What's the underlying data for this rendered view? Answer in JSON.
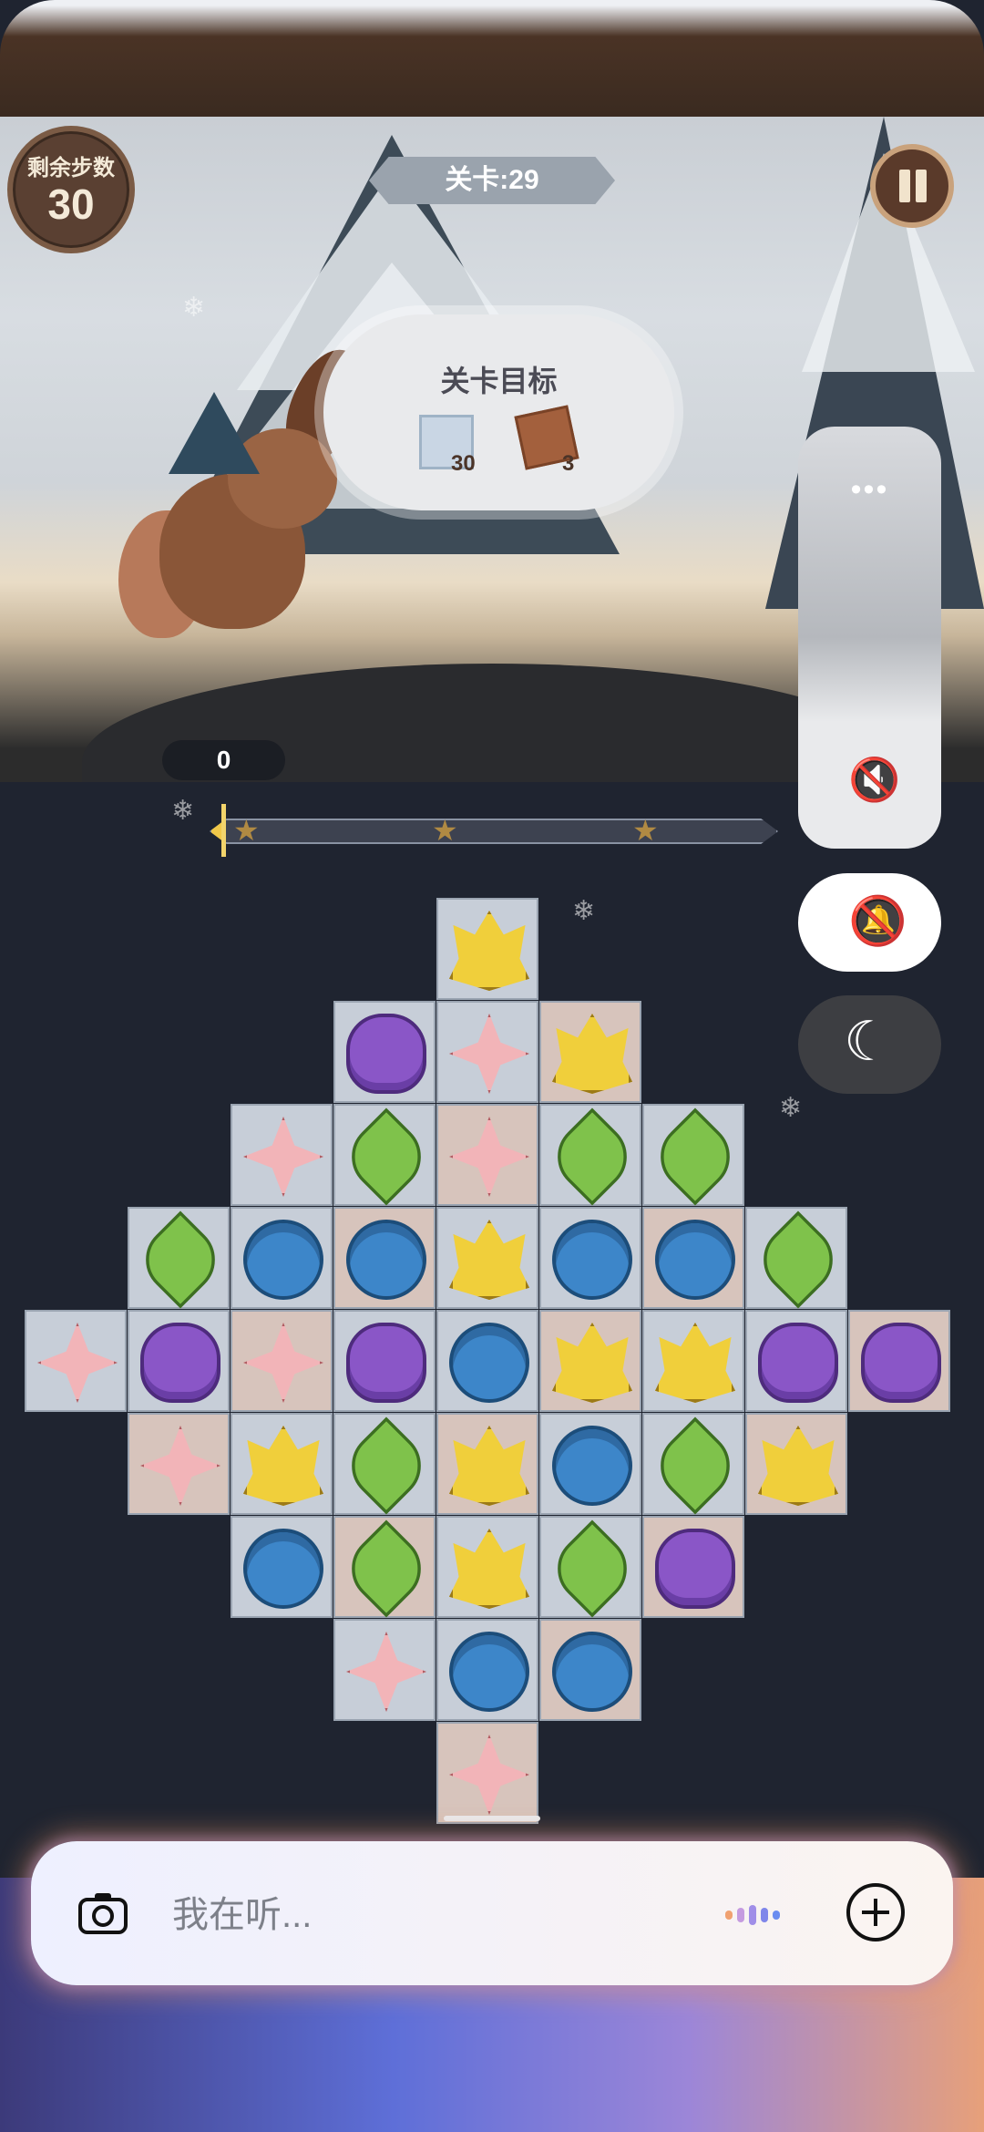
{
  "hud": {
    "steps_label": "剩余步数",
    "steps_value": "30",
    "level_label": "关卡:29"
  },
  "goal": {
    "title": "关卡目标",
    "items": [
      {
        "icon": "ice-tile-icon",
        "count": "30"
      },
      {
        "icon": "crate-icon",
        "count": "3"
      }
    ]
  },
  "score": {
    "value": "0",
    "progress": 0.02,
    "stars": 3
  },
  "board": {
    "rows": [
      [
        "-",
        "-",
        "-",
        "-",
        "yellow",
        "-",
        "-",
        "-",
        "-"
      ],
      [
        "-",
        "-",
        "-",
        "purple",
        "pink",
        "yellow",
        "-",
        "-",
        "-"
      ],
      [
        "-",
        "-",
        "pink",
        "green",
        "pink",
        "green",
        "green",
        "-",
        "-"
      ],
      [
        "-",
        "green",
        "blue",
        "blue",
        "yellow",
        "blue",
        "blue",
        "green",
        "-"
      ],
      [
        "pink",
        "purple",
        "pink",
        "purple",
        "blue",
        "yellow",
        "yellow",
        "purple",
        "purple"
      ],
      [
        "-",
        "pink",
        "yellow",
        "green",
        "yellow",
        "blue",
        "green",
        "yellow",
        "-"
      ],
      [
        "-",
        "-",
        "blue",
        "green",
        "yellow",
        "green",
        "purple",
        "-",
        "-"
      ],
      [
        "-",
        "-",
        "-",
        "pink",
        "blue",
        "blue",
        "-",
        "-",
        "-"
      ],
      [
        "-",
        "-",
        "-",
        "-",
        "pink",
        "-",
        "-",
        "-",
        "-"
      ]
    ],
    "colors": {
      "yellow": "#f0cf3b",
      "purple": "#8a56c7",
      "pink": "#f2b4b8",
      "green": "#7fc24b",
      "blue": "#3d86c9"
    }
  },
  "system_panel": {
    "more_label": "•••",
    "volume_icon": "speaker-muted-icon",
    "ring_icon": "bell-off-icon",
    "dnd_icon": "moon-icon"
  },
  "assistant": {
    "placeholder": "我在听...",
    "camera_icon": "camera-icon",
    "add_icon": "plus-circle-icon",
    "wave_colors": [
      "#f0a070",
      "#c59be0",
      "#a08ee8",
      "#7f86ea",
      "#6a8cf0"
    ]
  }
}
